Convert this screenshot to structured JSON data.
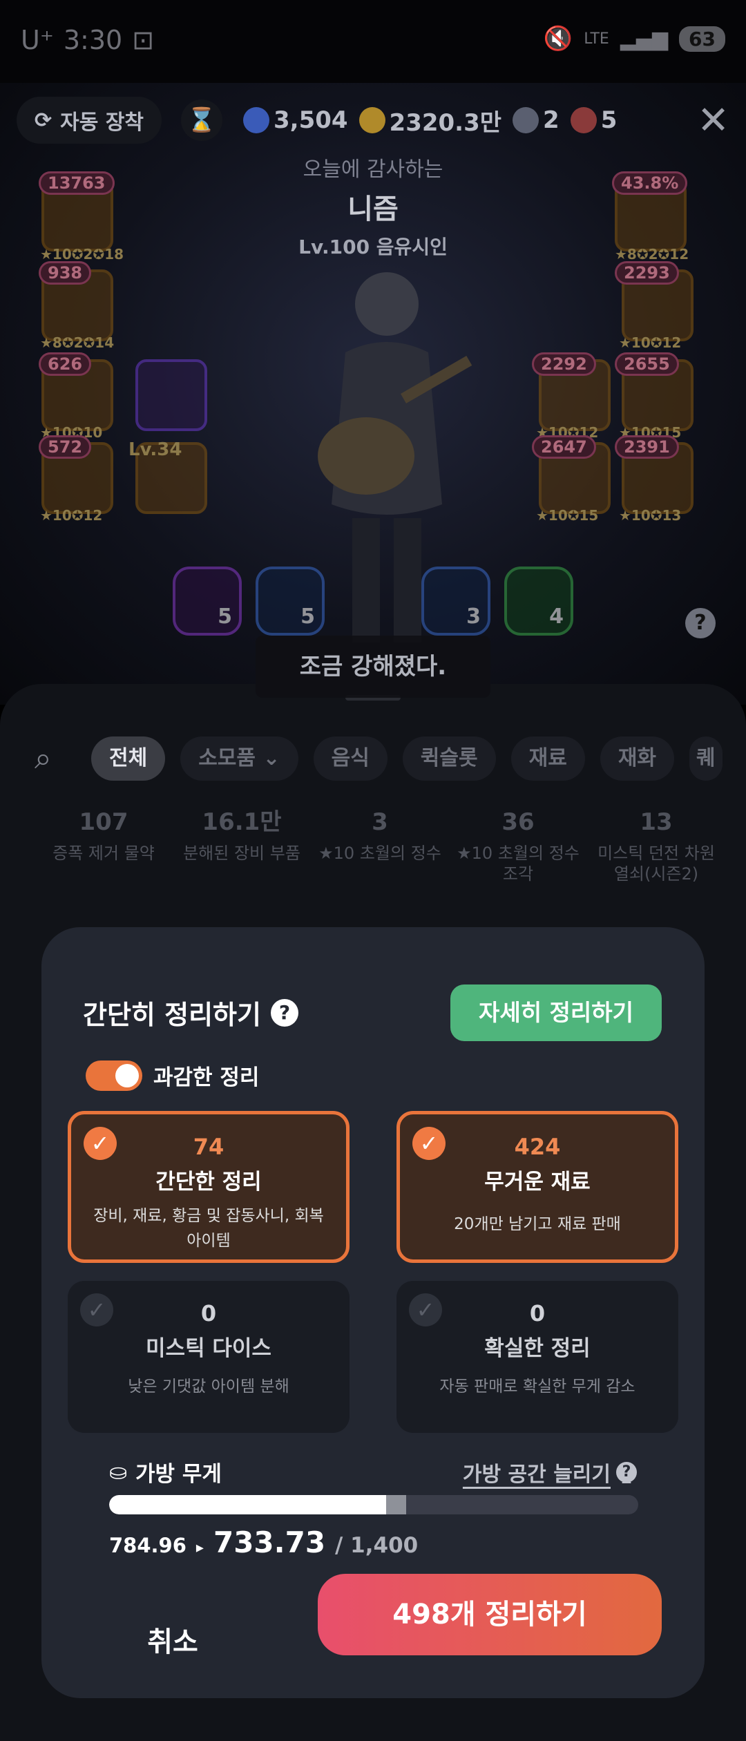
{
  "status_bar": {
    "carrier": "U⁺",
    "time": "3:30",
    "network": "LTE",
    "battery": "63"
  },
  "hud": {
    "auto_equip": "자동 장착",
    "currencies": [
      {
        "icon": "blue-orb",
        "value": "3,504",
        "color": "#3a5bb8"
      },
      {
        "icon": "gold-coin",
        "value": "2320.3만",
        "color": "#b08a2a"
      },
      {
        "icon": "dark-orb",
        "value": "2",
        "color": "#5a5f70"
      },
      {
        "icon": "demon-mask",
        "value": "5",
        "color": "#8a3a3a"
      }
    ]
  },
  "character": {
    "subtitle": "오늘에 감사하는",
    "name": "니즘",
    "level_class": "Lv.100 음유시인"
  },
  "equipment_left": [
    {
      "badge": "13763",
      "stars": "★10✪2✪18"
    },
    {
      "badge": "938",
      "stars": "★8✪2✪14"
    },
    {
      "badge": "626",
      "stars": "★10✪10"
    },
    {
      "badge": "572",
      "stars": "★10✪12"
    }
  ],
  "pet": {
    "level": "Lv.34"
  },
  "equipment_right": [
    {
      "badge": "43.8%",
      "stars": "★8✪2✪12"
    },
    {
      "badge": "2293",
      "stars": "★10✪12"
    },
    {
      "badge": "2292",
      "stars": "★10✪12"
    },
    {
      "badge": "2655",
      "stars": "★10✪15"
    },
    {
      "badge": "2647",
      "stars": "★10✪15"
    },
    {
      "badge": "2391",
      "stars": "★10✪13"
    }
  ],
  "consumables": [
    {
      "count": "5",
      "color": "#8a3acb"
    },
    {
      "count": "5",
      "color": "#3a6acb"
    },
    {
      "count": "3",
      "color": "#3a6acb"
    },
    {
      "count": "4",
      "color": "#3aab4a"
    }
  ],
  "toast": "조금 강해졌다.",
  "filters": [
    "전체",
    "소모품",
    "음식",
    "퀵슬롯",
    "재료",
    "재화",
    "퀘"
  ],
  "inventory_items": [
    {
      "count": "107",
      "name": "증폭 제거 물약"
    },
    {
      "count": "16.1만",
      "name": "분해된 장비 부품"
    },
    {
      "count": "3",
      "name": "★10 초월의 정수"
    },
    {
      "count": "36",
      "name": "★10 초월의 정수 조각"
    },
    {
      "count": "13",
      "name": "미스틱 던전 차원 열쇠(시즌2)"
    }
  ],
  "modal": {
    "title": "간단히 정리하기",
    "detail_button": "자세히 정리하기",
    "toggle_label": "과감한 정리",
    "toggle_on": true,
    "cards": [
      {
        "count": "74",
        "title": "간단한 정리",
        "desc": "장비, 재료, 황금 및 잡동사니, 회복 아이템",
        "selected": true
      },
      {
        "count": "424",
        "title": "무거운 재료",
        "desc": "20개만 남기고 재료 판매",
        "selected": true
      },
      {
        "count": "0",
        "title": "미스틱 다이스",
        "desc": "낮은 기댓값 아이템 분해",
        "selected": false
      },
      {
        "count": "0",
        "title": "확실한 정리",
        "desc": "자동 판매로 확실한 무게 감소",
        "selected": false
      }
    ],
    "bag_label": "가방 무게",
    "expand_link": "가방 공간 늘리기",
    "weight_before": "784.96",
    "weight_after": "733.73",
    "weight_max": "/ 1,400",
    "cancel": "취소",
    "confirm": "498개 정리하기"
  }
}
